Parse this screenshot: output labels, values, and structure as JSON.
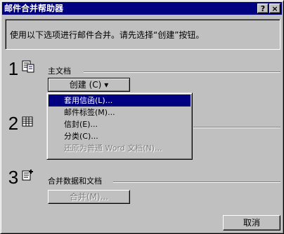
{
  "window": {
    "title": "邮件合并帮助器",
    "help_button": "?",
    "close_button": "×"
  },
  "info_text": "使用以下选项进行邮件合并。请先选择“创建”按钮。",
  "steps": [
    {
      "number": "1",
      "icon": "main-document-icon",
      "label": "主文档"
    },
    {
      "number": "2",
      "icon": "data-source-icon",
      "label": ""
    },
    {
      "number": "3",
      "icon": "merge-icon",
      "label": "合并数据和文档"
    }
  ],
  "create_button": {
    "label": "创建",
    "accelerator": "(C)",
    "arrow": "▾"
  },
  "create_menu": {
    "items": [
      {
        "label": "套用信函(L)...",
        "state": "selected"
      },
      {
        "label": "邮件标签(M)...",
        "state": "enabled"
      },
      {
        "label": "信封(E)...",
        "state": "enabled"
      },
      {
        "label": "分类(C)...",
        "state": "enabled"
      },
      {
        "label": "还原为普通 Word 文档(N)...",
        "state": "disabled"
      }
    ]
  },
  "merge_button": {
    "label": "合并(M)..."
  },
  "close_button": {
    "label": "取消"
  },
  "colors": {
    "face": "#c0c0c0",
    "titlebar": "#000080",
    "highlight": "#000080",
    "disabled_text": "#808080"
  }
}
